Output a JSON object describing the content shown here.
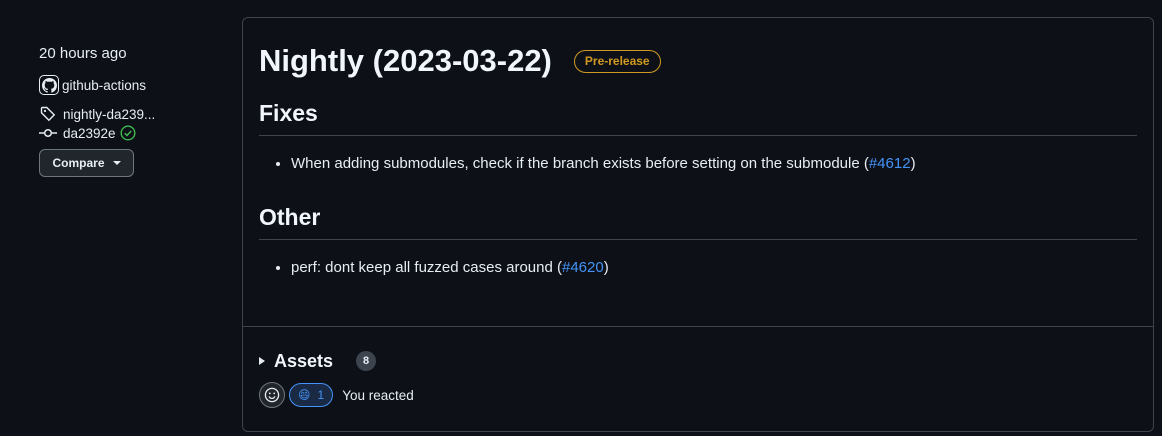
{
  "sidebar": {
    "time": "20 hours ago",
    "author": "github-actions",
    "tag": "nightly-da239...",
    "commit": "da2392e",
    "compare_label": "Compare"
  },
  "release": {
    "title": "Nightly (2023-03-22)",
    "badge": "Pre-release",
    "sections": [
      {
        "heading": "Fixes",
        "items": [
          {
            "text": "When adding submodules, check if the branch exists before setting on the submodule (",
            "link": "#4612",
            "suffix": ")"
          }
        ]
      },
      {
        "heading": "Other",
        "items": [
          {
            "text": "perf: dont keep all fuzzed cases around (",
            "link": "#4620",
            "suffix": ")"
          }
        ]
      }
    ],
    "assets_label": "Assets",
    "assets_count": "8",
    "reaction_emoji": "😄",
    "reaction_count": "1",
    "reacted_text": "You reacted"
  },
  "colors": {
    "background": "#0d1117",
    "accent_link": "#4493f8",
    "prerelease": "#d29922",
    "success": "#3fb950"
  }
}
